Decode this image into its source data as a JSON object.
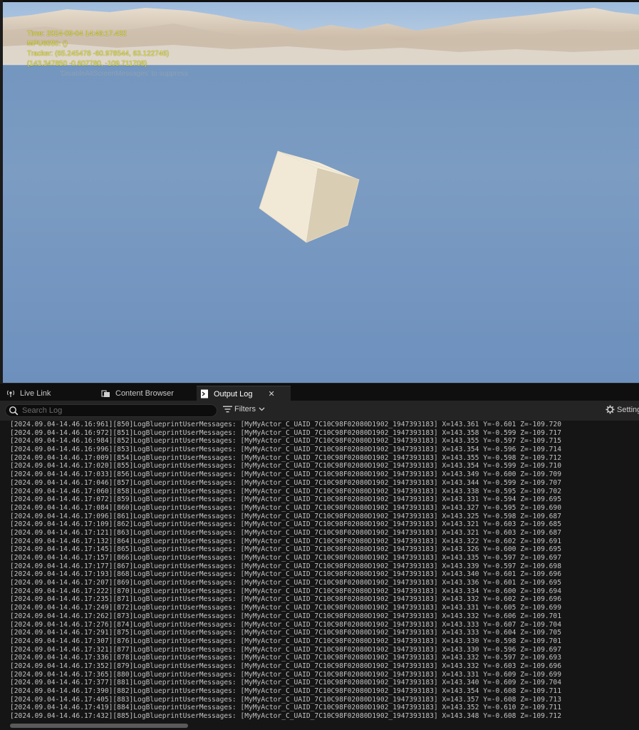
{
  "viewport": {
    "debug_lines": [
      "Time: 2024-09-04 14:46:17.432",
      "MPU6050: ()",
      "Tracker: (65.245478 -60.978544, 63.122746)",
      "(143.347850 -0.607780, -109.711708)"
    ],
    "suppress_text": "'DisableAllScreenMessages' to suppress"
  },
  "tabs": [
    {
      "label": "Live Link",
      "icon": "live-link-icon"
    },
    {
      "label": "Content Browser",
      "icon": "content-browser-icon"
    },
    {
      "label": "Output Log",
      "icon": "output-log-icon",
      "active": true
    }
  ],
  "toolbar": {
    "search_placeholder": "Search Log",
    "filters_label": "Filters",
    "settings_label": "Settings"
  },
  "log": {
    "lines": [
      "[2024.09.04-14.46.16:961][850]LogBlueprintUserMessages: [MyMyActor_C_UAID_7C10C98F02080D1902_1947393183] X=143.361 Y=-0.601 Z=-109.720",
      "[2024.09.04-14.46.16:972][851]LogBlueprintUserMessages: [MyMyActor_C_UAID_7C10C98F02080D1902_1947393183] X=143.358 Y=-0.599 Z=-109.717",
      "[2024.09.04-14.46.16:984][852]LogBlueprintUserMessages: [MyMyActor_C_UAID_7C10C98F02080D1902_1947393183] X=143.355 Y=-0.597 Z=-109.715",
      "[2024.09.04-14.46.16:996][853]LogBlueprintUserMessages: [MyMyActor_C_UAID_7C10C98F02080D1902_1947393183] X=143.354 Y=-0.596 Z=-109.714",
      "[2024.09.04-14.46.17:009][854]LogBlueprintUserMessages: [MyMyActor_C_UAID_7C10C98F02080D1902_1947393183] X=143.355 Y=-0.598 Z=-109.712",
      "[2024.09.04-14.46.17:020][855]LogBlueprintUserMessages: [MyMyActor_C_UAID_7C10C98F02080D1902_1947393183] X=143.354 Y=-0.599 Z=-109.710",
      "[2024.09.04-14.46.17:033][856]LogBlueprintUserMessages: [MyMyActor_C_UAID_7C10C98F02080D1902_1947393183] X=143.349 Y=-0.600 Z=-109.709",
      "[2024.09.04-14.46.17:046][857]LogBlueprintUserMessages: [MyMyActor_C_UAID_7C10C98F02080D1902_1947393183] X=143.344 Y=-0.599 Z=-109.707",
      "[2024.09.04-14.46.17:060][858]LogBlueprintUserMessages: [MyMyActor_C_UAID_7C10C98F02080D1902_1947393183] X=143.338 Y=-0.595 Z=-109.702",
      "[2024.09.04-14.46.17:072][859]LogBlueprintUserMessages: [MyMyActor_C_UAID_7C10C98F02080D1902_1947393183] X=143.331 Y=-0.594 Z=-109.695",
      "[2024.09.04-14.46.17:084][860]LogBlueprintUserMessages: [MyMyActor_C_UAID_7C10C98F02080D1902_1947393183] X=143.327 Y=-0.595 Z=-109.690",
      "[2024.09.04-14.46.17:096][861]LogBlueprintUserMessages: [MyMyActor_C_UAID_7C10C98F02080D1902_1947393183] X=143.325 Y=-0.598 Z=-109.687",
      "[2024.09.04-14.46.17:109][862]LogBlueprintUserMessages: [MyMyActor_C_UAID_7C10C98F02080D1902_1947393183] X=143.321 Y=-0.603 Z=-109.685",
      "[2024.09.04-14.46.17:121][863]LogBlueprintUserMessages: [MyMyActor_C_UAID_7C10C98F02080D1902_1947393183] X=143.321 Y=-0.603 Z=-109.687",
      "[2024.09.04-14.46.17:132][864]LogBlueprintUserMessages: [MyMyActor_C_UAID_7C10C98F02080D1902_1947393183] X=143.322 Y=-0.602 Z=-109.691",
      "[2024.09.04-14.46.17:145][865]LogBlueprintUserMessages: [MyMyActor_C_UAID_7C10C98F02080D1902_1947393183] X=143.326 Y=-0.600 Z=-109.695",
      "[2024.09.04-14.46.17:157][866]LogBlueprintUserMessages: [MyMyActor_C_UAID_7C10C98F02080D1902_1947393183] X=143.335 Y=-0.597 Z=-109.697",
      "[2024.09.04-14.46.17:177][867]LogBlueprintUserMessages: [MyMyActor_C_UAID_7C10C98F02080D1902_1947393183] X=143.339 Y=-0.597 Z=-109.698",
      "[2024.09.04-14.46.17:193][868]LogBlueprintUserMessages: [MyMyActor_C_UAID_7C10C98F02080D1902_1947393183] X=143.340 Y=-0.601 Z=-109.696",
      "[2024.09.04-14.46.17:207][869]LogBlueprintUserMessages: [MyMyActor_C_UAID_7C10C98F02080D1902_1947393183] X=143.336 Y=-0.601 Z=-109.695",
      "[2024.09.04-14.46.17:222][870]LogBlueprintUserMessages: [MyMyActor_C_UAID_7C10C98F02080D1902_1947393183] X=143.334 Y=-0.600 Z=-109.694",
      "[2024.09.04-14.46.17:235][871]LogBlueprintUserMessages: [MyMyActor_C_UAID_7C10C98F02080D1902_1947393183] X=143.332 Y=-0.602 Z=-109.696",
      "[2024.09.04-14.46.17:249][872]LogBlueprintUserMessages: [MyMyActor_C_UAID_7C10C98F02080D1902_1947393183] X=143.331 Y=-0.605 Z=-109.699",
      "[2024.09.04-14.46.17:262][873]LogBlueprintUserMessages: [MyMyActor_C_UAID_7C10C98F02080D1902_1947393183] X=143.332 Y=-0.606 Z=-109.701",
      "[2024.09.04-14.46.17:276][874]LogBlueprintUserMessages: [MyMyActor_C_UAID_7C10C98F02080D1902_1947393183] X=143.333 Y=-0.607 Z=-109.704",
      "[2024.09.04-14.46.17:291][875]LogBlueprintUserMessages: [MyMyActor_C_UAID_7C10C98F02080D1902_1947393183] X=143.333 Y=-0.604 Z=-109.705",
      "[2024.09.04-14.46.17:307][876]LogBlueprintUserMessages: [MyMyActor_C_UAID_7C10C98F02080D1902_1947393183] X=143.330 Y=-0.598 Z=-109.701",
      "[2024.09.04-14.46.17:321][877]LogBlueprintUserMessages: [MyMyActor_C_UAID_7C10C98F02080D1902_1947393183] X=143.330 Y=-0.596 Z=-109.697",
      "[2024.09.04-14.46.17:336][878]LogBlueprintUserMessages: [MyMyActor_C_UAID_7C10C98F02080D1902_1947393183] X=143.332 Y=-0.597 Z=-109.693",
      "[2024.09.04-14.46.17:352][879]LogBlueprintUserMessages: [MyMyActor_C_UAID_7C10C98F02080D1902_1947393183] X=143.332 Y=-0.603 Z=-109.696",
      "[2024.09.04-14.46.17:365][880]LogBlueprintUserMessages: [MyMyActor_C_UAID_7C10C98F02080D1902_1947393183] X=143.331 Y=-0.609 Z=-109.699",
      "[2024.09.04-14.46.17:377][881]LogBlueprintUserMessages: [MyMyActor_C_UAID_7C10C98F02080D1902_1947393183] X=143.340 Y=-0.609 Z=-109.704",
      "[2024.09.04-14.46.17:390][882]LogBlueprintUserMessages: [MyMyActor_C_UAID_7C10C98F02080D1902_1947393183] X=143.354 Y=-0.608 Z=-109.711",
      "[2024.09.04-14.46.17:405][883]LogBlueprintUserMessages: [MyMyActor_C_UAID_7C10C98F02080D1902_1947393183] X=143.357 Y=-0.608 Z=-109.713",
      "[2024.09.04-14.46.17:419][884]LogBlueprintUserMessages: [MyMyActor_C_UAID_7C10C98F02080D1902_1947393183] X=143.352 Y=-0.610 Z=-109.711",
      "[2024.09.04-14.46.17:432][885]LogBlueprintUserMessages: [MyMyActor_C_UAID_7C10C98F02080D1902_1947393183] X=143.348 Y=-0.608 Z=-109.712"
    ]
  },
  "colors": {
    "debug_text": "#e8e94a",
    "sky": "#7c9cc2",
    "panel_bg": "#151515",
    "log_text": "#c3c3c3"
  }
}
